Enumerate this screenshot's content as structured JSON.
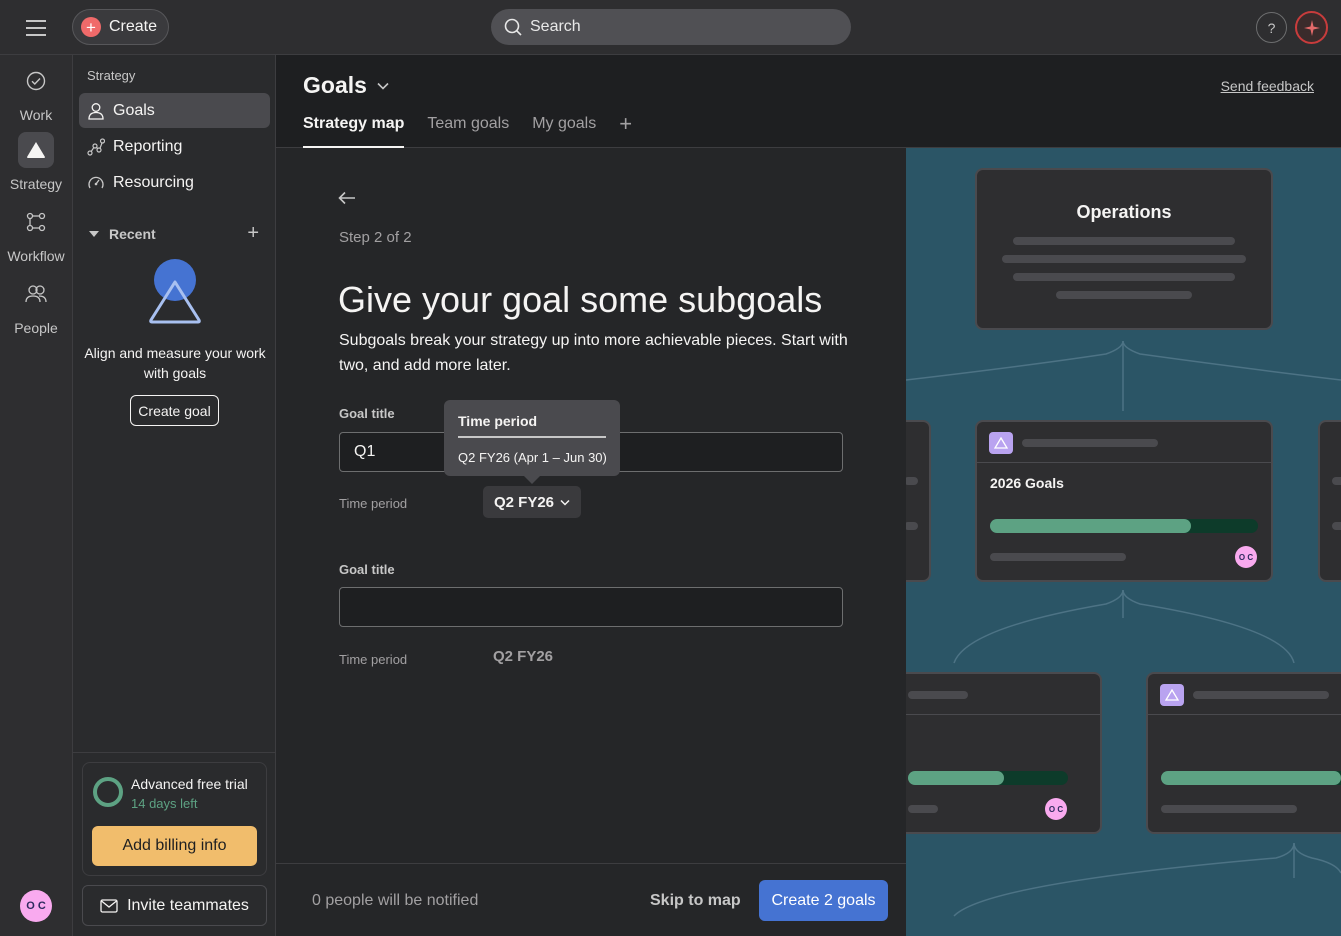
{
  "topbar": {
    "create_label": "Create",
    "search_placeholder": "Search",
    "help_label": "?"
  },
  "rail": {
    "items": [
      {
        "label": "Work",
        "icon": "check-circle-icon"
      },
      {
        "label": "Strategy",
        "icon": "triangle-icon"
      },
      {
        "label": "Workflow",
        "icon": "workflow-icon"
      },
      {
        "label": "People",
        "icon": "people-icon"
      }
    ],
    "avatar_initials": "O C"
  },
  "sidebar": {
    "section": "Strategy",
    "items": [
      {
        "label": "Goals",
        "icon": "person-icon"
      },
      {
        "label": "Reporting",
        "icon": "reporting-icon"
      },
      {
        "label": "Resourcing",
        "icon": "gauge-icon"
      }
    ],
    "recent_label": "Recent",
    "promo_text": "Align and measure your work with goals",
    "promo_button": "Create goal",
    "trial": {
      "title": "Advanced free trial",
      "days_left": "14 days left",
      "billing_button": "Add billing info"
    },
    "invite_label": "Invite teammates"
  },
  "header": {
    "title": "Goals",
    "feedback": "Send feedback",
    "tabs": [
      {
        "label": "Strategy map",
        "active": true
      },
      {
        "label": "Team goals"
      },
      {
        "label": "My goals"
      }
    ]
  },
  "form": {
    "step": "Step 2 of 2",
    "heading": "Give your goal some subgoals",
    "description": "Subgoals break your strategy up into more achievable pieces. Start with two, and add more later.",
    "goals": [
      {
        "title_label": "Goal title",
        "value": "Q1",
        "period_label": "Time period",
        "period": "Q2 FY26"
      },
      {
        "title_label": "Goal title",
        "value": "",
        "period_label": "Time period",
        "period": "Q2 FY26"
      }
    ],
    "tooltip": {
      "title": "Time period",
      "body": "Q2 FY26 (Apr 1 – Jun 30)"
    },
    "footer": {
      "notify": "0 people will be notified",
      "skip": "Skip to map",
      "create": "Create 2 goals"
    }
  },
  "illustration": {
    "top_card_title": "Operations",
    "mid_card_title": "2026 Goals",
    "avatar_initials": "O C",
    "colors": {
      "background": "#2b5566",
      "progress": "#5da283",
      "goal_icon": "#b9a3f0"
    },
    "progress": {
      "mid_card": 0.75,
      "bottom_left": 0.6,
      "bottom_right": 0.9
    }
  }
}
